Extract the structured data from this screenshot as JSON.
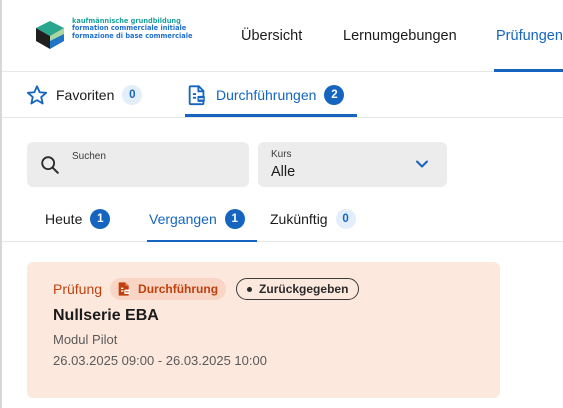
{
  "brand": {
    "line1": "kaufmännische grundbildung",
    "line2": "formation commerciale initiale",
    "line3": "formazione di base commerciale"
  },
  "nav": {
    "items": [
      {
        "label": "Übersicht"
      },
      {
        "label": "Lernumgebungen"
      },
      {
        "label": "Prüfungen",
        "active": true
      }
    ]
  },
  "subtabs": {
    "favoriten": {
      "label": "Favoriten",
      "count": "0"
    },
    "durchfuehrungen": {
      "label": "Durchführungen",
      "count": "2",
      "active": true
    }
  },
  "filters": {
    "search": {
      "label": "Suchen",
      "value": ""
    },
    "kurs": {
      "label": "Kurs",
      "value": "Alle"
    }
  },
  "timetabs": {
    "heute": {
      "label": "Heute",
      "count": "1"
    },
    "vergangen": {
      "label": "Vergangen",
      "count": "1",
      "active": true
    },
    "zukuenftig": {
      "label": "Zukünftig",
      "count": "0"
    }
  },
  "card": {
    "type": "Prüfung",
    "chip": "Durchführung",
    "status": "Zurückgegeben",
    "title": "Nullserie EBA",
    "subtitle": "Modul Pilot",
    "date": "26.03.2025 09:00 - 26.03.2025 10:00"
  },
  "colors": {
    "accent": "#1565c0",
    "card_bg": "#fde8dd",
    "card_accent": "#c0410e",
    "brand_teal": "#1aa39a"
  },
  "icons": [
    "logo-icon",
    "star-icon",
    "document-execution-icon",
    "search-icon",
    "chevron-down-icon"
  ]
}
